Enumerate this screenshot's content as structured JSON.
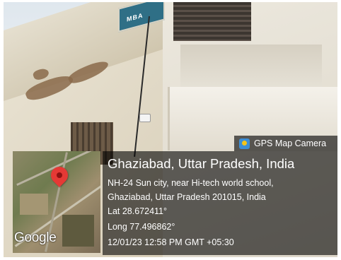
{
  "badge": {
    "app_name": "GPS Map Camera",
    "icon": "gps-map-camera-app-icon"
  },
  "location": {
    "title": "Ghaziabad, Uttar Pradesh, India",
    "address_line1": "NH-24 Sun city, near Hi-tech world school,",
    "address_line2": "Ghaziabad, Uttar Pradesh 201015, India",
    "lat": "Lat 28.672411°",
    "long": "Long 77.496862°",
    "datetime": "12/01/23 12:58 PM GMT +05:30"
  },
  "map": {
    "attribution": "Google",
    "marker_color": "#e53935"
  },
  "scene": {
    "sign_text": "MBA"
  }
}
